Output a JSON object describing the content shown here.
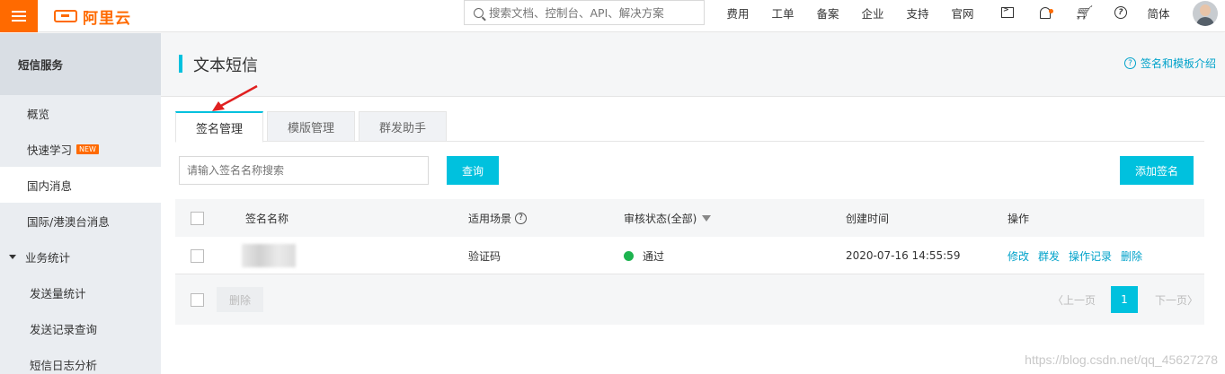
{
  "brand": {
    "logo_text": "阿里云"
  },
  "search": {
    "placeholder": "搜索文档、控制台、API、解决方案"
  },
  "topnav": {
    "links": [
      "费用",
      "工单",
      "备案",
      "企业",
      "支持",
      "官网"
    ],
    "lang": "简体",
    "icons": [
      "terminal-icon",
      "bell-icon",
      "cart-icon",
      "help-icon"
    ],
    "accent": "#ff6a00"
  },
  "sidebar": {
    "title": "短信服务",
    "items": [
      {
        "label": "概览"
      },
      {
        "label": "快速学习",
        "badge": "NEW"
      },
      {
        "label": "国内消息"
      },
      {
        "label": "国际/港澳台消息"
      },
      {
        "label": "业务统计"
      },
      {
        "label": "发送量统计"
      },
      {
        "label": "发送记录查询"
      },
      {
        "label": "短信日志分析"
      }
    ]
  },
  "page": {
    "title": "文本短信",
    "help_link": "签名和模板介绍"
  },
  "tabs": [
    {
      "label": "签名管理"
    },
    {
      "label": "模版管理"
    },
    {
      "label": "群发助手"
    }
  ],
  "toolbar": {
    "query_placeholder": "请输入签名名称搜索",
    "query_button": "查询",
    "add_button": "添加签名"
  },
  "table": {
    "headers": {
      "name": "签名名称",
      "scene": "适用场景",
      "status": "审核状态(全部)",
      "created": "创建时间",
      "ops": "操作"
    },
    "rows": [
      {
        "name": "",
        "scene": "验证码",
        "status": "通过",
        "created": "2020-07-16 14:55:59",
        "ops": [
          "修改",
          "群发",
          "操作记录",
          "删除"
        ]
      }
    ]
  },
  "footer": {
    "delete": "删除",
    "prev": "上一页",
    "page": "1",
    "next": "下一页"
  },
  "watermark": "https://blog.csdn.net/qq_45627278"
}
